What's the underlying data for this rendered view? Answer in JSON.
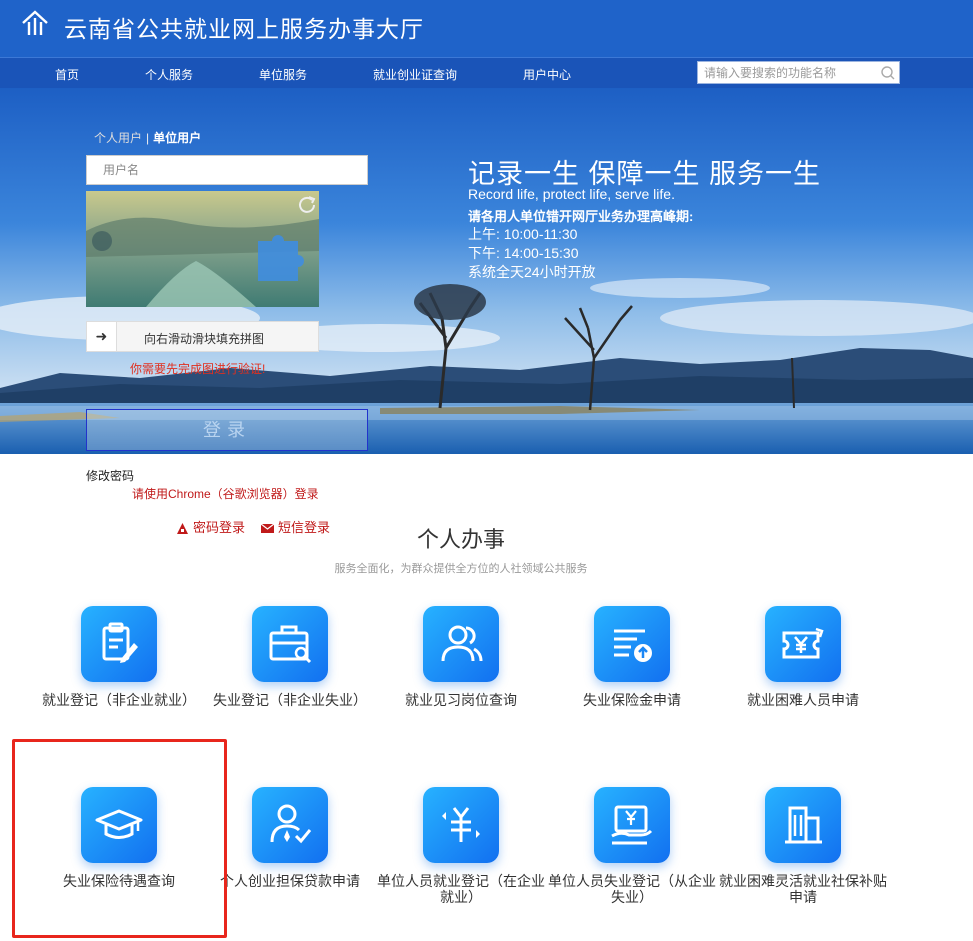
{
  "header": {
    "title": "云南省公共就业网上服务办事大厅"
  },
  "nav": {
    "items": [
      "首页",
      "个人服务",
      "单位服务",
      "就业创业证查询",
      "用户中心"
    ],
    "search_placeholder": "请输入要搜索的功能名称"
  },
  "login": {
    "tab_personal": "个人用户",
    "tab_separator": "|",
    "tab_unit": "单位用户",
    "username_placeholder": "用户名",
    "slider_hint": "向右滑动滑块填充拼图",
    "slider_arrow": "➜",
    "captcha_warning": "你需要先完成图进行验证!",
    "login_button": "登录",
    "change_password": "修改密码",
    "chrome_tip": "请使用Chrome（谷歌浏览器）登录",
    "password_login": "密码登录",
    "sms_login": "短信登录"
  },
  "banner": {
    "slogan": "记录一生 保障一生 服务一生",
    "slogan_en": "Record life, protect life, serve life.",
    "peak_notice": "请各用人单位错开网厅业务办理高峰期:",
    "morning": "上午: 10:00-11:30",
    "afternoon": "下午: 14:00-15:30",
    "system_open": "系统全天24小时开放"
  },
  "section": {
    "title": "个人办事",
    "subtitle": "服务全面化，为群众提供全方位的人社领域公共服务"
  },
  "services": [
    {
      "label": "就业登记（非企业就业）",
      "icon": "edit-document-icon"
    },
    {
      "label": "失业登记（非企业失业）",
      "icon": "toolbox-search-icon"
    },
    {
      "label": "就业见习岗位查询",
      "icon": "users-icon"
    },
    {
      "label": "失业保险金申请",
      "icon": "list-upload-icon"
    },
    {
      "label": "就业困难人员申请",
      "icon": "yen-ticket-icon"
    },
    {
      "label": "失业保险待遇查询",
      "icon": "graduation-cap-icon"
    },
    {
      "label": "个人创业担保贷款申请",
      "icon": "person-check-icon"
    },
    {
      "label": "单位人员就业登记（在企业就业）",
      "icon": "yen-arrows-icon"
    },
    {
      "label": "单位人员失业登记（从企业失业）",
      "icon": "yen-hand-icon"
    },
    {
      "label": "就业困难灵活就业社保补贴申请",
      "icon": "building-icon"
    }
  ],
  "colors": {
    "header": "#1f63c9",
    "nav": "#1a54b8",
    "icon_start": "#27b2ff",
    "icon_end": "#1270f0",
    "highlight": "#e8261c",
    "tip_red": "#c01a1a"
  }
}
